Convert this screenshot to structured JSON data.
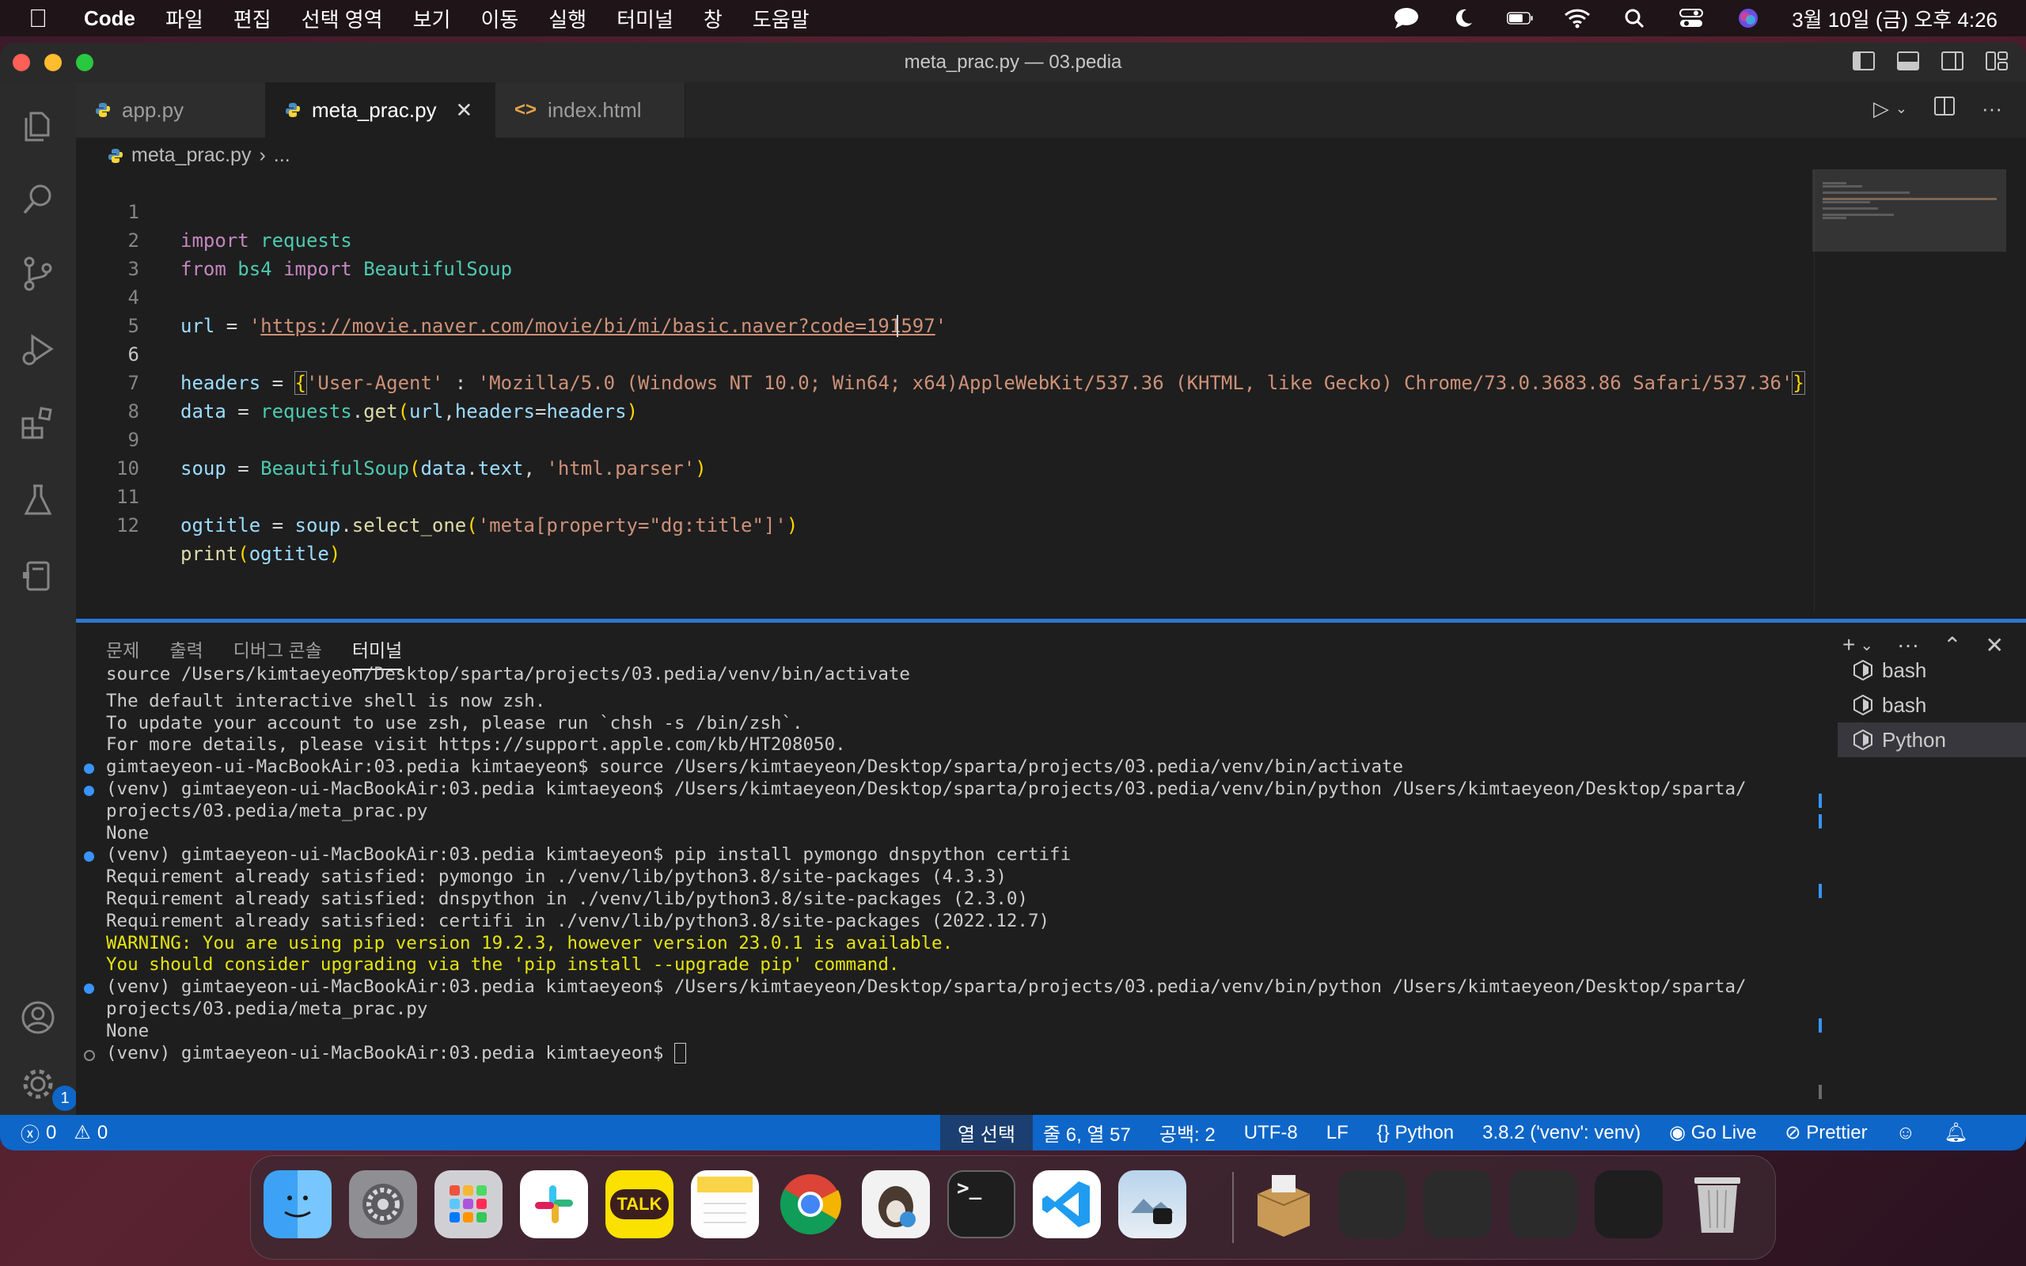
{
  "menubar": {
    "app": "Code",
    "items": [
      "파일",
      "편집",
      "선택 영역",
      "보기",
      "이동",
      "실행",
      "터미널",
      "창",
      "도움말"
    ],
    "datetime": "3월 10일 (금) 오후 4:26"
  },
  "window": {
    "title": "meta_prac.py — 03.pedia"
  },
  "tabs": [
    {
      "label": "app.py",
      "icon": "python-icon"
    },
    {
      "label": "meta_prac.py",
      "icon": "python-icon",
      "active": true
    },
    {
      "label": "index.html",
      "icon": "html-icon"
    }
  ],
  "breadcrumb": {
    "file": "meta_prac.py",
    "rest": "..."
  },
  "editor": {
    "current_line": 6,
    "lines": [
      "1",
      "2",
      "3",
      "4",
      "5",
      "6",
      "7",
      "8",
      "9",
      "10",
      "11",
      "12"
    ]
  },
  "code": {
    "l1": {
      "k": "import",
      "m": "requests"
    },
    "l2": {
      "k1": "from",
      "m1": "bs4",
      "k2": "import",
      "m2": "BeautifulSoup"
    },
    "l4": {
      "v": "url",
      "op": " = ",
      "q": "'",
      "url": "https://movie.naver.com/movie/bi/mi/basic.naver?code=191597"
    },
    "l6": {
      "v": "headers",
      "op": " = ",
      "ob": "{",
      "key": "'User-Agent'",
      "colon": " : ",
      "val": "'Mozilla/5.0 (Windows NT 10.0; Win64; x64)AppleWebKit/537.36 (KHTML, like Gecko) Chrome/73.0.3683.86 Safari/537.36'",
      "cb": "}"
    },
    "l7": {
      "v": "data",
      "op": " = ",
      "m": "requests",
      "dot": ".",
      "f": "get",
      "op2": "(",
      "a1": "url",
      "c": ",",
      "a2": "headers",
      "eq": "=",
      "a3": "headers",
      "cp": ")"
    },
    "l9": {
      "v": "soup",
      "op": " = ",
      "f": "BeautifulSoup",
      "op2": "(",
      "a1": "data",
      "dot": ".",
      "a2": "text",
      "c": ", ",
      "s": "'html.parser'",
      "cp": ")"
    },
    "l11": {
      "v": "ogtitle",
      "op": " = ",
      "a": "soup",
      "dot": ".",
      "f": "select_one",
      "op2": "(",
      "s": "'meta[property=\"dg:title\"]'",
      "cp": ")"
    },
    "l12": {
      "f": "print",
      "op2": "(",
      "a": "ogtitle",
      "cp": ")"
    }
  },
  "panel": {
    "tabs": [
      "문제",
      "출력",
      "디버그 콘솔",
      "터미널"
    ],
    "active_tab": "터미널",
    "terminal_lines": [
      {
        "text": "source /Users/kimtaeyeon/Desktop/sparta/projects/03.pedia/venv/bin/activate",
        "dot": ""
      },
      {
        "text": "",
        "dot": ""
      },
      {
        "text": "The default interactive shell is now zsh.",
        "dot": ""
      },
      {
        "text": "To update your account to use zsh, please run `chsh -s /bin/zsh`.",
        "dot": ""
      },
      {
        "text": "For more details, please visit https://support.apple.com/kb/HT208050.",
        "dot": ""
      },
      {
        "text": "gimtaeyeon-ui-MacBookAir:03.pedia kimtaeyeon$ source /Users/kimtaeyeon/Desktop/sparta/projects/03.pedia/venv/bin/activate",
        "dot": "blue"
      },
      {
        "text": "(venv) gimtaeyeon-ui-MacBookAir:03.pedia kimtaeyeon$ /Users/kimtaeyeon/Desktop/sparta/projects/03.pedia/venv/bin/python /Users/kimtaeyeon/Desktop/sparta/",
        "dot": "blue"
      },
      {
        "text": "projects/03.pedia/meta_prac.py",
        "dot": ""
      },
      {
        "text": "None",
        "dot": ""
      },
      {
        "text": "(venv) gimtaeyeon-ui-MacBookAir:03.pedia kimtaeyeon$ pip install pymongo dnspython certifi",
        "dot": "blue"
      },
      {
        "text": "Requirement already satisfied: pymongo in ./venv/lib/python3.8/site-packages (4.3.3)",
        "dot": ""
      },
      {
        "text": "Requirement already satisfied: dnspython in ./venv/lib/python3.8/site-packages (2.3.0)",
        "dot": ""
      },
      {
        "text": "Requirement already satisfied: certifi in ./venv/lib/python3.8/site-packages (2022.12.7)",
        "dot": ""
      },
      {
        "text": "WARNING: You are using pip version 19.2.3, however version 23.0.1 is available.",
        "dot": "",
        "warn": true
      },
      {
        "text": "You should consider upgrading via the 'pip install --upgrade pip' command.",
        "dot": "",
        "warn": true
      },
      {
        "text": "(venv) gimtaeyeon-ui-MacBookAir:03.pedia kimtaeyeon$ /Users/kimtaeyeon/Desktop/sparta/projects/03.pedia/venv/bin/python /Users/kimtaeyeon/Desktop/sparta/",
        "dot": "blue"
      },
      {
        "text": "projects/03.pedia/meta_prac.py",
        "dot": ""
      },
      {
        "text": "None",
        "dot": ""
      },
      {
        "text": "(venv) gimtaeyeon-ui-MacBookAir:03.pedia kimtaeyeon$ ",
        "dot": "hollow",
        "cursor": true
      }
    ],
    "terminals": [
      {
        "label": "bash",
        "active": false
      },
      {
        "label": "bash",
        "active": false
      },
      {
        "label": "Python",
        "active": true
      }
    ]
  },
  "status": {
    "errors": "0",
    "warnings": "0",
    "selection_mode": "열 선택",
    "position": "줄 6, 열 57",
    "spaces": "공백: 2",
    "encoding": "UTF-8",
    "eol": "LF",
    "language": "Python",
    "interpreter": "3.8.2 ('venv': venv)",
    "golive": "Go Live",
    "prettier": "Prettier"
  },
  "activity": {
    "settings_badge": "1"
  },
  "dock": {
    "talk_label": "TALK",
    "apps": [
      "finder",
      "system-settings",
      "launchpad",
      "slack",
      "kakaotalk",
      "notes",
      "chrome",
      "sequel-ace",
      "terminal",
      "vscode",
      "preview"
    ]
  },
  "colors": {
    "accent": "#0e66c8",
    "panel_border": "#2f76d3",
    "warning": "#e5e510"
  }
}
